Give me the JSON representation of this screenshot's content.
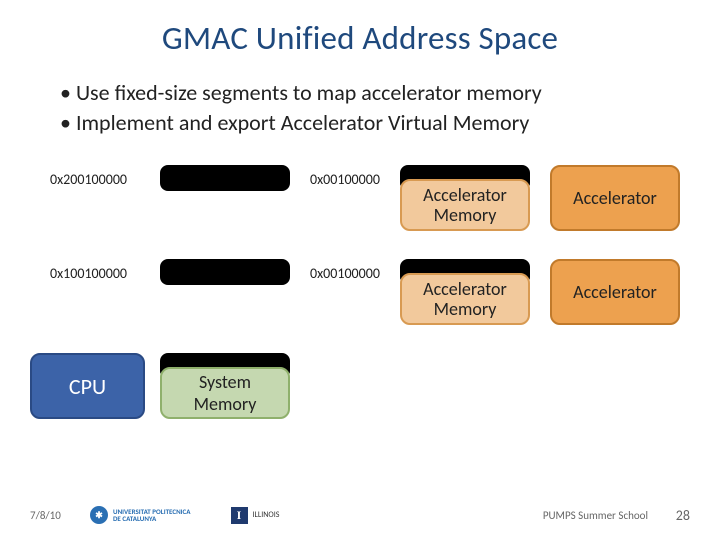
{
  "title": "GMAC Unified Address Space",
  "bullets": [
    "Use fixed-size segments to map accelerator memory",
    "Implement and export Accelerator Virtual Memory"
  ],
  "diagram": {
    "rows": [
      {
        "left_addr": "0x200100000",
        "right_addr": "0x00100000",
        "mem_label": "Accelerator\nMemory",
        "accel_label": "Accelerator"
      },
      {
        "left_addr": "0x100100000",
        "right_addr": "0x00100000",
        "mem_label": "Accelerator\nMemory",
        "accel_label": "Accelerator"
      }
    ],
    "cpu_label": "CPU",
    "sysmem_label": "System\nMemory"
  },
  "footer": {
    "date": "7/8/10",
    "upc_text": "UNIVERSITAT POLITECNICA\nDE CATALUNYA",
    "ill_text": "ILLINOIS",
    "pumps": "PUMPS Summer School",
    "page": "28"
  }
}
